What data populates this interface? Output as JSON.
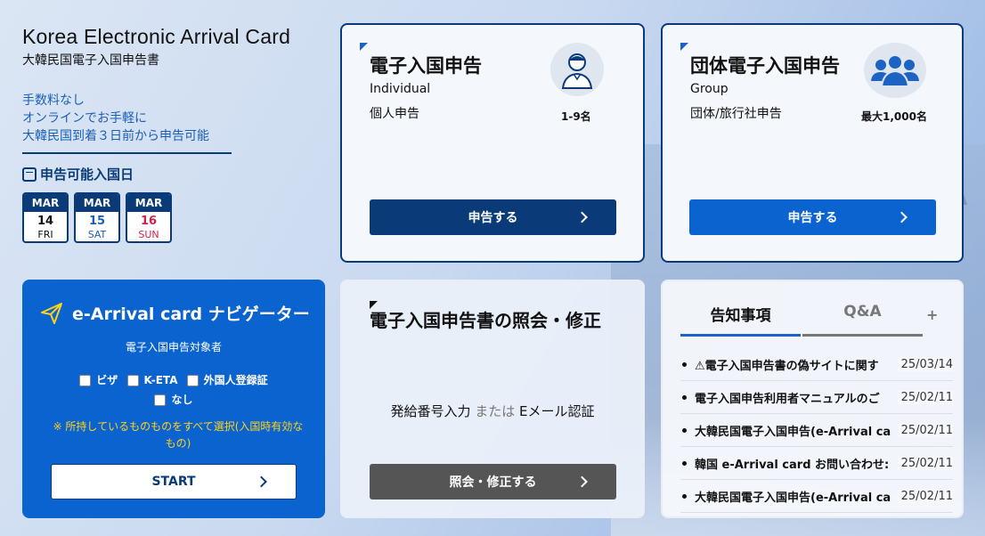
{
  "intro": {
    "title": "Korea Electronic Arrival Card",
    "subtitle": "大韓民国電子入国申告書",
    "features": [
      "手数料なし",
      "オンラインでお手軽に",
      "大韓民国到着３日前から申告可能"
    ],
    "dates_title": "申告可能入国日",
    "dates": [
      {
        "month": "MAR",
        "day": "14",
        "weekday": "FRI"
      },
      {
        "month": "MAR",
        "day": "15",
        "weekday": "SAT"
      },
      {
        "month": "MAR",
        "day": "16",
        "weekday": "SUN"
      }
    ]
  },
  "individual": {
    "title": "電子入国申告",
    "en": "Individual",
    "jp": "個人申告",
    "count": "1-9名",
    "button": "申告する"
  },
  "group": {
    "title": "団体電子入国申告",
    "en": "Group",
    "jp": "団体/旅行社申告",
    "count": "最大1,000名",
    "button": "申告する"
  },
  "navigator": {
    "title": "e-Arrival card ナビゲーター",
    "subtitle": "電子入国申告対象者",
    "options": [
      "ビザ",
      "K-ETA",
      "外国人登録証",
      "なし"
    ],
    "note": "※ 所持しているものものをすべて選択(入国時有効なもの)",
    "start": "START"
  },
  "inquiry": {
    "title": "電子入国申告書の照会・修正",
    "desc_a": "発給番号入力",
    "desc_or": "または",
    "desc_b": "Eメール認証",
    "button": "照会・修正する"
  },
  "notices": {
    "tab_active": "告知事項",
    "tab_inactive": "Q&A",
    "plus": "+",
    "items": [
      {
        "title": "⚠電子入国申告書の偽サイトに関す",
        "date": "25/03/14"
      },
      {
        "title": "電子入国申告利用者マニュアルのご",
        "date": "25/02/11"
      },
      {
        "title": "大韓民国電子入国申告(e-Arrival ca",
        "date": "25/02/11"
      },
      {
        "title": "韓国 e-Arrival card お問い合わせ:",
        "date": "25/02/11"
      },
      {
        "title": "大韓民国電子入国申告(e-Arrival ca",
        "date": "25/02/11"
      }
    ]
  },
  "colors": {
    "navy": "#0a3b78",
    "blue": "#0b63cf",
    "gray_button": "#555555",
    "note_yellow": "#ffd21a"
  }
}
